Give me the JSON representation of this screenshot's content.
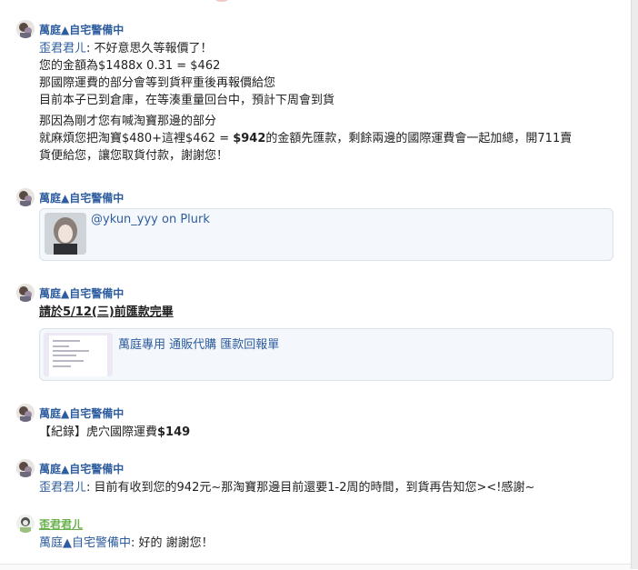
{
  "colors": {
    "mention": "#2e5d9f",
    "name_blue": "#2e5d9f",
    "name_green": "#68b04a",
    "card_bg": "#f4f7fb"
  },
  "responses": [
    {
      "author": "萬庭▲自宅警備中",
      "paragraphs": [
        [
          {
            "mention": "歪君君ㄦ",
            "text": ": 不好意思久等報價了！"
          },
          {
            "text": "您的金額為$1488x 0.31 = $462"
          },
          {
            "text": "那國際運費的部分會等到貨秤重後再報價給您"
          },
          {
            "text": "目前本子已到倉庫，在等湊重量回台中，預計下周會到貨"
          }
        ],
        [
          {
            "text": "那因為剛才您有喊淘寶那邊的部分"
          },
          {
            "pre": "就麻煩您把淘寶$480+這裡$462 = ",
            "bold": "$942",
            "post": "的金額先匯款，剩餘兩邊的國際運費會一起加總，開711賣"
          },
          {
            "text": "貨便給您，讓您取貨付款，謝謝您！"
          }
        ]
      ]
    },
    {
      "author": "萬庭▲自宅警備中",
      "card": {
        "text": "@ykun_yyy on Plurk"
      }
    },
    {
      "author": "萬庭▲自宅警備中",
      "heading": "請於5/12(三)前匯款完畢",
      "card": {
        "text": "萬庭專用 通販代購 匯款回報單"
      }
    },
    {
      "author": "萬庭▲自宅警備中",
      "line": {
        "pre": "【紀錄】虎穴國際運費",
        "bold": "$149"
      }
    },
    {
      "author": "萬庭▲自宅警備中",
      "line": {
        "mention": "歪君君ㄦ",
        "text": ": 目前有收到您的942元~那淘寶那邊目前還要1-2周的時間，到貨再告知您><!感謝~"
      }
    },
    {
      "author": "歪君君ㄦ",
      "line": {
        "mention": "萬庭▲自宅警備中",
        "text": ": 好的 謝謝您！"
      }
    }
  ]
}
